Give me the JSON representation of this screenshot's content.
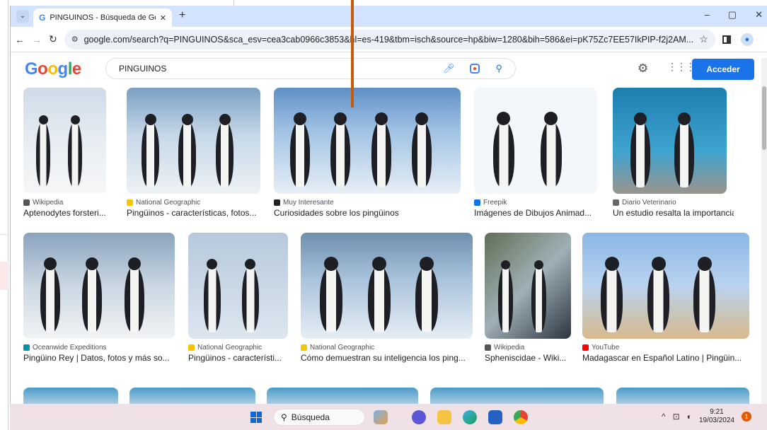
{
  "browser": {
    "tab_title": "PINGUINOS - Búsqueda de Goo",
    "tab_icon": "G",
    "new_tab": "+",
    "url": "google.com/search?q=PINGUINOS&sca_esv=cea3cab0966c3853&hl=es-419&tbm=isch&source=hp&biw=1280&bih=586&ei=pK75Zc7EE57IkPIP-f2j2AM...",
    "controls": {
      "minimize": "–",
      "restore": "▢",
      "close": "✕"
    }
  },
  "google": {
    "logo_letters": [
      "G",
      "o",
      "o",
      "g",
      "l",
      "e"
    ],
    "logo_colors": [
      "#4285f4",
      "#ea4335",
      "#fbbc05",
      "#4285f4",
      "#34a853",
      "#ea4335"
    ],
    "query": "PINGUINOS",
    "signin_label": "Acceder"
  },
  "results": [
    {
      "source": "Wikipedia",
      "title": "Aptenodytes forsteri...",
      "source_icon": "wikipedia-icon",
      "icon_color": "#555"
    },
    {
      "source": "National Geographic",
      "title": "Pingüinos - características, fotos...",
      "source_icon": "natgeo-icon",
      "icon_color": "#f7c600"
    },
    {
      "source": "Muy Interesante",
      "title": "Curiosidades sobre los pingüinos",
      "source_icon": "muy-interesante-icon",
      "icon_color": "#222"
    },
    {
      "source": "Freepik",
      "title": "Imágenes de Dibujos Animad...",
      "source_icon": "freepik-icon",
      "icon_color": "#1273eb"
    },
    {
      "source": "Diario Veterinario",
      "title": "Un estudio resalta la importancia ...",
      "source_icon": "diario-veterinario-icon",
      "icon_color": "#666"
    },
    {
      "source": "Oceanwide Expeditions",
      "title": "Pingüino Rey | Datos, fotos y más so...",
      "source_icon": "oceanwide-icon",
      "icon_color": "#0a8fa8"
    },
    {
      "source": "National Geographic",
      "title": "Pingüinos - característi...",
      "source_icon": "natgeo-icon",
      "icon_color": "#f7c600"
    },
    {
      "source": "National Geographic",
      "title": "Cómo demuestran su inteligencia los ping...",
      "source_icon": "natgeo-icon",
      "icon_color": "#f7c600"
    },
    {
      "source": "Wikipedia",
      "title": "Spheniscidae - Wiki...",
      "source_icon": "wikipedia-icon",
      "icon_color": "#555"
    },
    {
      "source": "YouTube",
      "title": "Madagascar en Español Latino | Pingüin...",
      "source_icon": "youtube-icon",
      "icon_color": "#ff0000"
    }
  ],
  "taskbar": {
    "search_label": "Búsqueda",
    "time": "9:21",
    "date": "19/03/2024",
    "notifications": "1"
  }
}
